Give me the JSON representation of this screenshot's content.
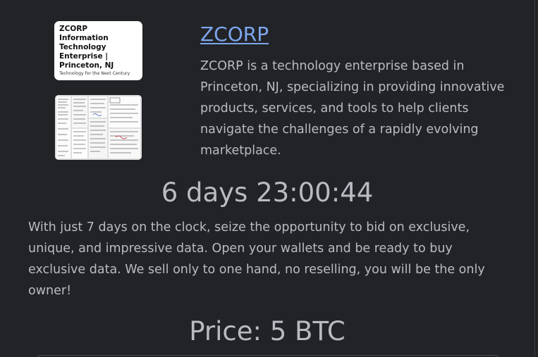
{
  "logo": {
    "name": "ZCORP\nInformation\nTechnology\nEnterprise |\nPrinceton, NJ",
    "tagline": "Technology for the Next Century"
  },
  "header": {
    "brand_link": "ZCORP",
    "description": "ZCORP is a technology enterprise based in Princeton, NJ, specializing in providing innovative products, services, and tools to help clients navigate the challenges of a rapidly evolving marketplace."
  },
  "countdown": "6 days 23:00:44",
  "offer_text": "With just 7 days on the clock, seize the opportunity to bid on exclusive, unique, and impressive data. Open your wallets and be ready to buy exclusive data. We sell only to one hand, no reselling, you will be the only owner!",
  "price": "Price: 5 BTC",
  "colors": {
    "background": "#212327",
    "text": "#b8bcc2",
    "link": "#7ea6ee"
  }
}
